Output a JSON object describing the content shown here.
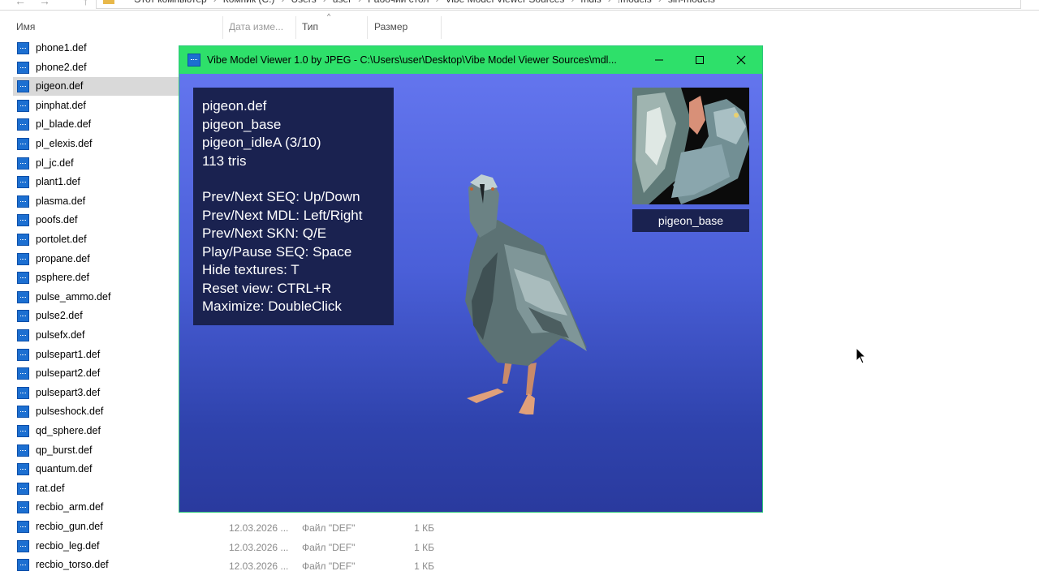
{
  "explorer": {
    "nav": {
      "back": "←",
      "forward": "→",
      "up": "↑"
    },
    "breadcrumbs": [
      "Этот компьютер",
      "Компик (C:)",
      "Users",
      "user",
      "Рабочий стол",
      "Vibe Model Viewer Sources",
      "mdls",
      "!models",
      "sin-models"
    ],
    "columns": {
      "name": "Имя",
      "date": "Дата изме...",
      "type": "Тип",
      "size": "Размер"
    },
    "files": [
      {
        "name": "phone1.def"
      },
      {
        "name": "phone2.def"
      },
      {
        "name": "pigeon.def"
      },
      {
        "name": "pinphat.def"
      },
      {
        "name": "pl_blade.def"
      },
      {
        "name": "pl_elexis.def"
      },
      {
        "name": "pl_jc.def"
      },
      {
        "name": "plant1.def"
      },
      {
        "name": "plasma.def"
      },
      {
        "name": "poofs.def"
      },
      {
        "name": "portolet.def"
      },
      {
        "name": "propane.def"
      },
      {
        "name": "psphere.def"
      },
      {
        "name": "pulse_ammo.def"
      },
      {
        "name": "pulse2.def"
      },
      {
        "name": "pulsefx.def"
      },
      {
        "name": "pulsepart1.def"
      },
      {
        "name": "pulsepart2.def"
      },
      {
        "name": "pulsepart3.def"
      },
      {
        "name": "pulseshock.def"
      },
      {
        "name": "qd_sphere.def"
      },
      {
        "name": "qp_burst.def"
      },
      {
        "name": "quantum.def"
      },
      {
        "name": "rat.def"
      },
      {
        "name": "recbio_arm.def"
      },
      {
        "name": "recbio_gun.def"
      },
      {
        "name": "recbio_leg.def"
      },
      {
        "name": "recbio_torso.def"
      }
    ],
    "selected_index": 2,
    "visible_meta": [
      {
        "date": "12.03.2026 ...",
        "type": "Файл \"DEF\"",
        "size": "1 КБ"
      },
      {
        "date": "12.03.2026 ...",
        "type": "Файл \"DEF\"",
        "size": "1 КБ"
      },
      {
        "date": "12.03.2026 ...",
        "type": "Файл \"DEF\"",
        "size": "1 КБ"
      }
    ]
  },
  "viewer": {
    "title": "Vibe Model Viewer 1.0 by JPEG - C:\\Users\\user\\Desktop\\Vibe Model Viewer Sources\\mdl...",
    "info": {
      "file": "pigeon.def",
      "model": "pigeon_base",
      "sequence": "pigeon_idleA (3/10)",
      "tris": "113 tris",
      "help": [
        "Prev/Next SEQ: Up/Down",
        "Prev/Next MDL: Left/Right",
        "Prev/Next SKN: Q/E",
        "Play/Pause SEQ: Space",
        "Hide textures: T",
        "Reset view: CTRL+R",
        "Maximize: DoubleClick"
      ]
    },
    "texture_label": "pigeon_base",
    "colors": {
      "titlebar": "#2ee06a",
      "viewport_top": "#6375ee",
      "viewport_bottom": "#2a3a9e",
      "info_panel": "#1a2250"
    }
  }
}
